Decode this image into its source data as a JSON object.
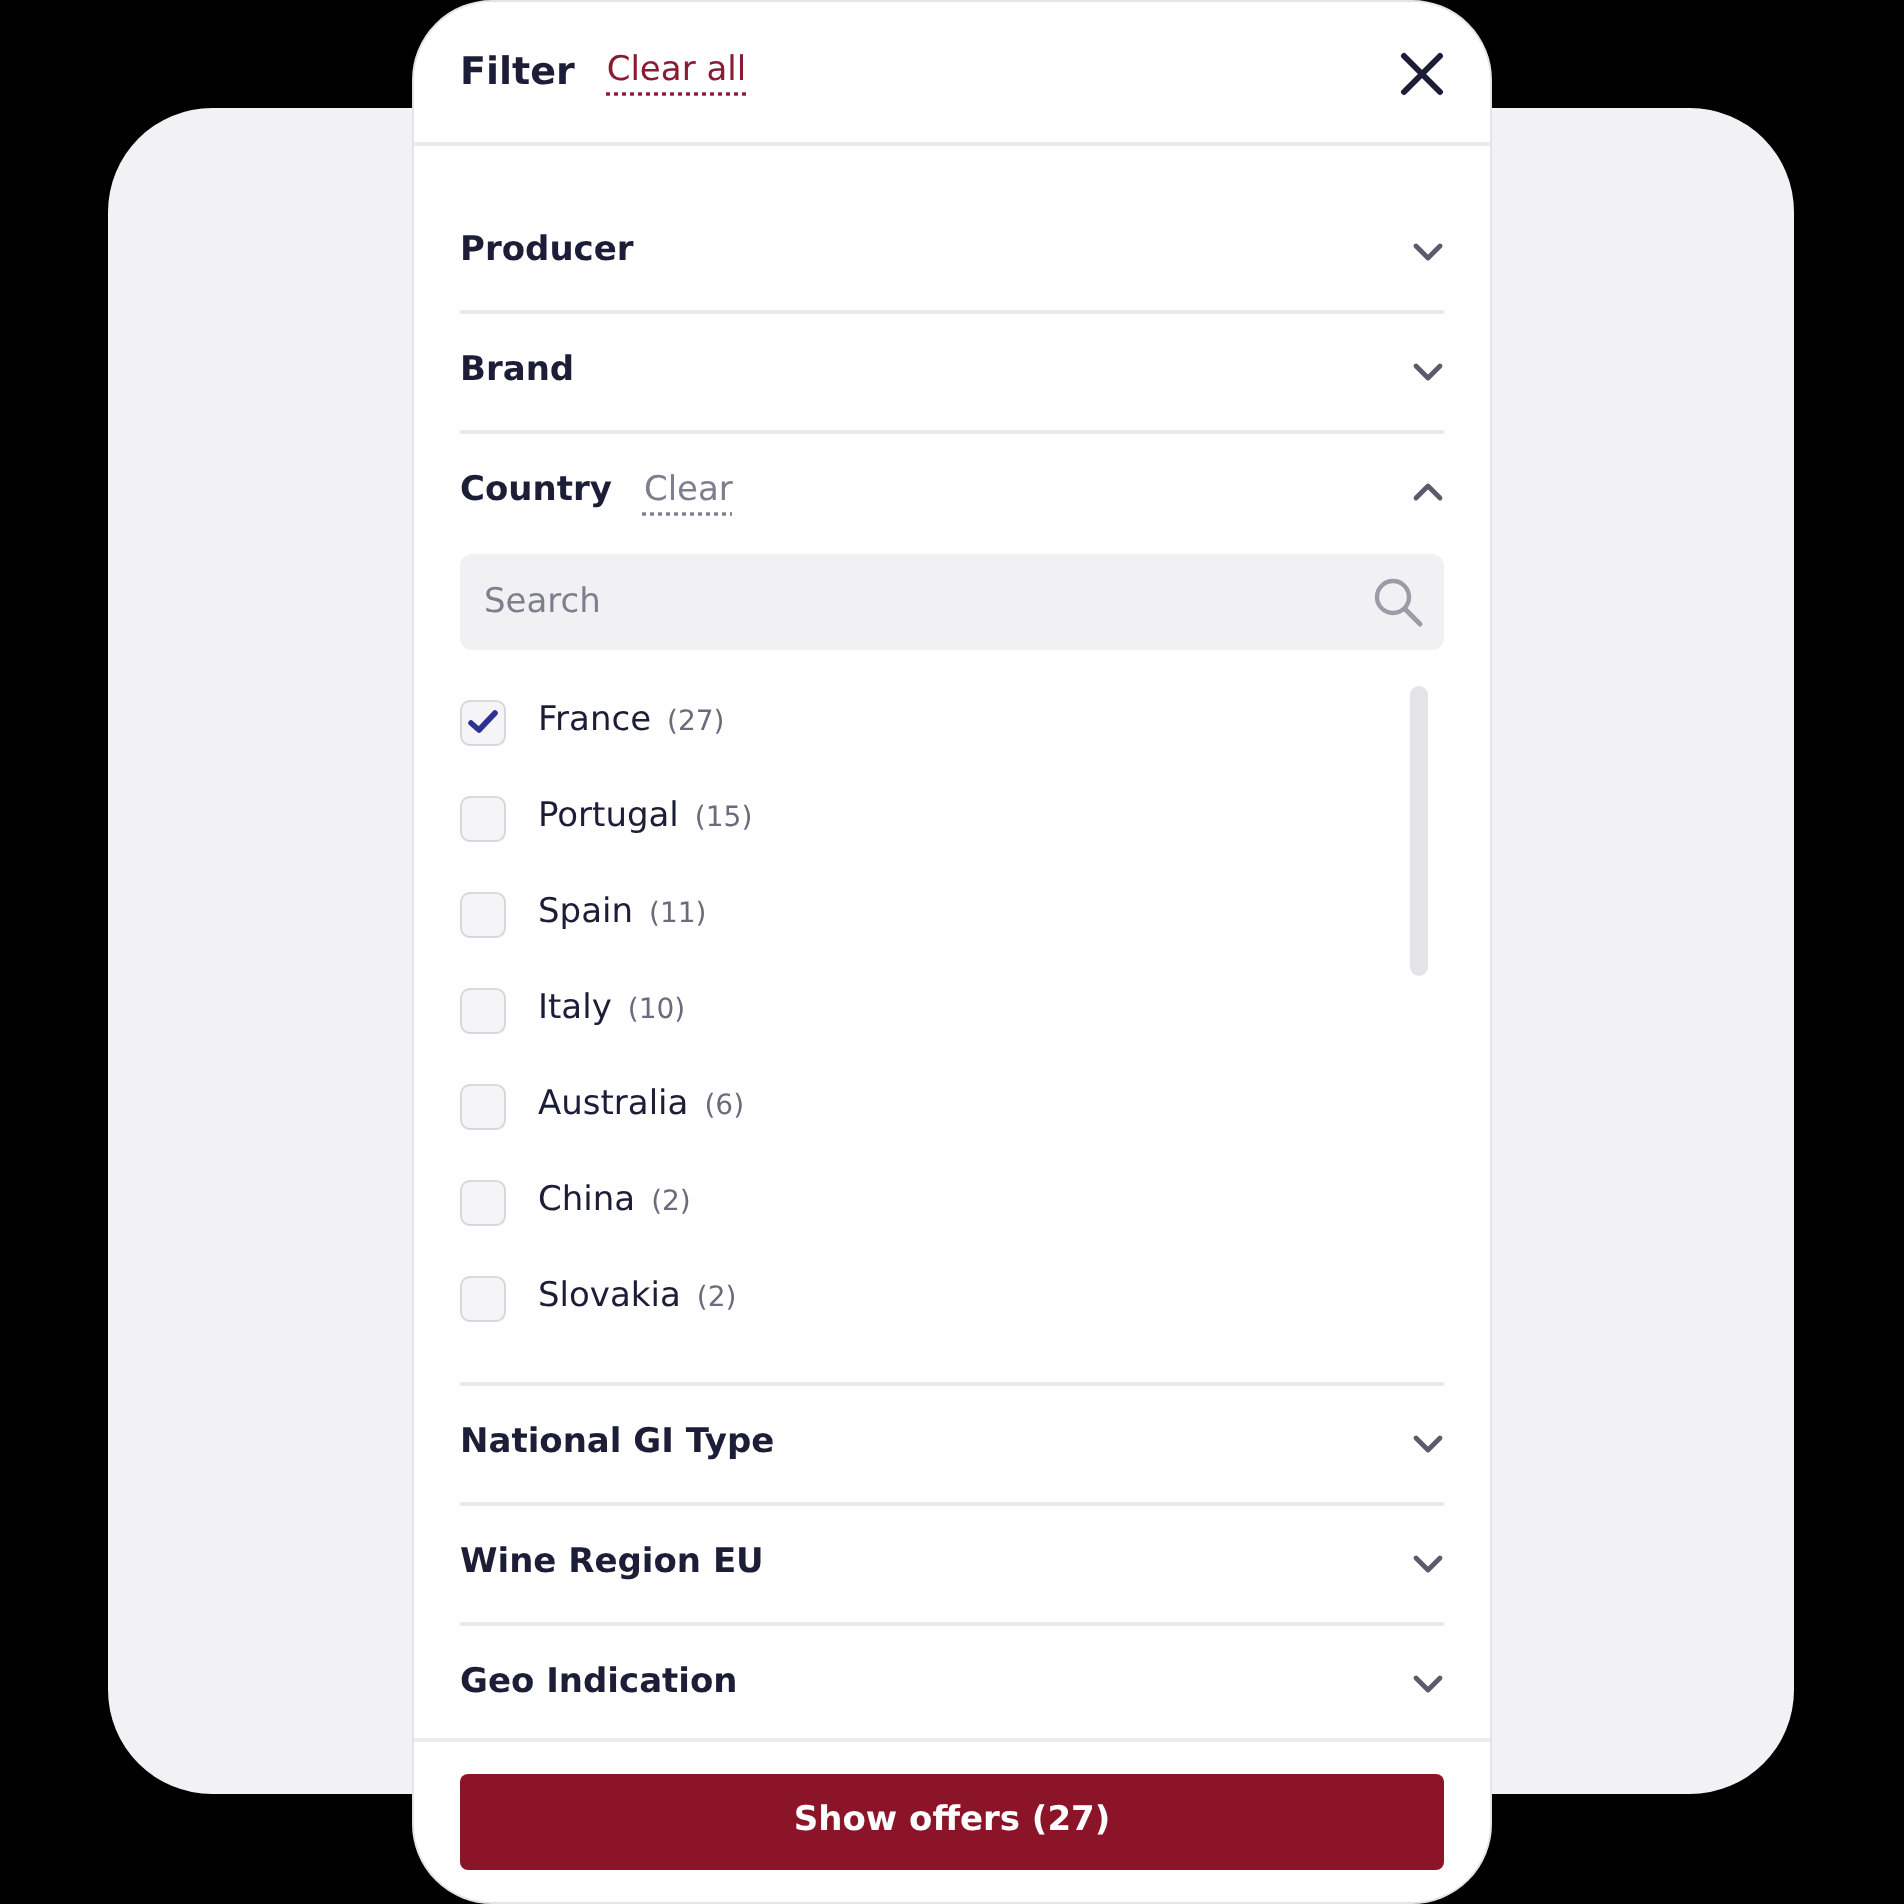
{
  "header": {
    "title": "Filter",
    "clear_all": "Clear all"
  },
  "sections": [
    {
      "title": "Producer",
      "expanded": false
    },
    {
      "title": "Brand",
      "expanded": false
    },
    {
      "title": "Country",
      "expanded": true,
      "clear_label": "Clear",
      "search": {
        "placeholder": "Search"
      },
      "options": [
        {
          "label": "France",
          "count": "(27)",
          "checked": true
        },
        {
          "label": "Portugal",
          "count": "(15)",
          "checked": false
        },
        {
          "label": "Spain",
          "count": "(11)",
          "checked": false
        },
        {
          "label": "Italy",
          "count": "(10)",
          "checked": false
        },
        {
          "label": "Australia",
          "count": "(6)",
          "checked": false
        },
        {
          "label": "China",
          "count": "(2)",
          "checked": false
        },
        {
          "label": "Slovakia",
          "count": "(2)",
          "checked": false
        }
      ]
    },
    {
      "title": "National GI Type",
      "expanded": false
    },
    {
      "title": "Wine Region EU",
      "expanded": false
    },
    {
      "title": "Geo Indication",
      "expanded": false
    }
  ],
  "footer": {
    "button": "Show offers (27)"
  }
}
